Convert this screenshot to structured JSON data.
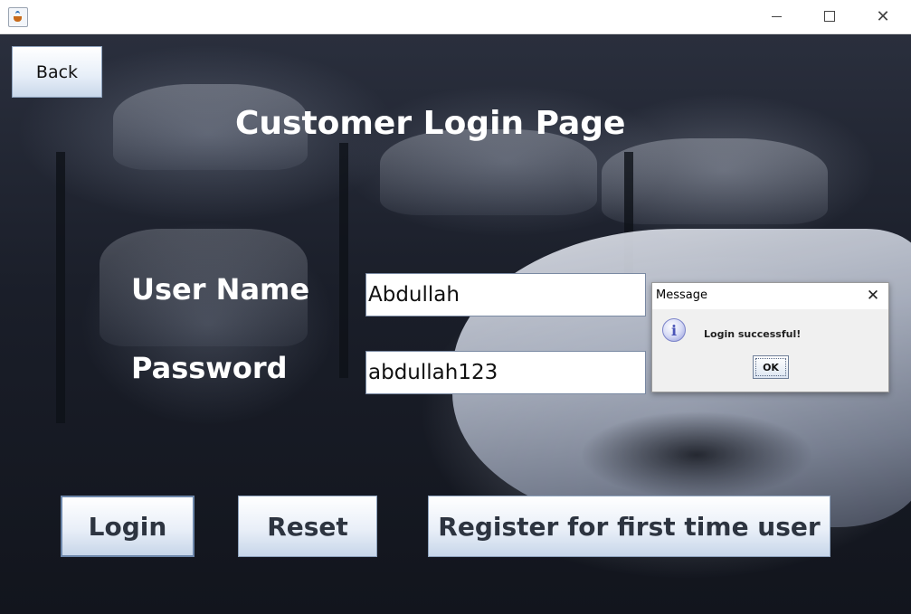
{
  "window": {
    "icon": "java-cup-icon",
    "controls": {
      "minimize": "minimize-icon",
      "maximize": "maximize-icon",
      "close": "close-icon"
    }
  },
  "page": {
    "back_label": "Back",
    "title": "Customer Login Page",
    "username_label": "User Name",
    "username_value": "Abdullah",
    "password_label": "Password",
    "password_value": "abdullah123",
    "buttons": {
      "login": "Login",
      "reset": "Reset",
      "register": "Register for first time user"
    }
  },
  "dialog": {
    "title": "Message",
    "icon": "info-icon",
    "icon_glyph": "i",
    "message": "Login successful!",
    "ok_label": "OK"
  }
}
